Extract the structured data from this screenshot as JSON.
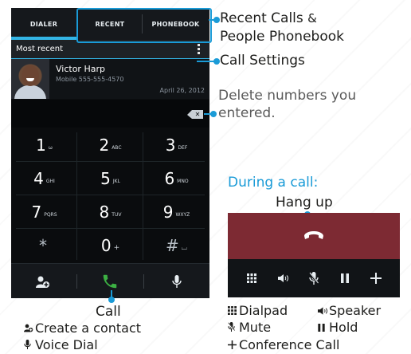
{
  "phone": {
    "tabs": [
      "DIALER",
      "RECENT",
      "PHONEBOOK"
    ],
    "recent_header": "Most recent",
    "contact": {
      "name": "Victor Harp",
      "number": "Mobile 555-555-4570",
      "date": "April 26, 2012"
    },
    "keys": [
      {
        "digit": "1",
        "letters": "ω"
      },
      {
        "digit": "2",
        "letters": "ABC"
      },
      {
        "digit": "3",
        "letters": "DEF"
      },
      {
        "digit": "4",
        "letters": "GHI"
      },
      {
        "digit": "5",
        "letters": "JKL"
      },
      {
        "digit": "6",
        "letters": "MNO"
      },
      {
        "digit": "7",
        "letters": "PQRS"
      },
      {
        "digit": "8",
        "letters": "TUV"
      },
      {
        "digit": "9",
        "letters": "WXYZ"
      },
      {
        "digit": "*",
        "letters": ""
      },
      {
        "digit": "0",
        "letters": "+"
      },
      {
        "digit": "#",
        "letters": "⌴"
      }
    ],
    "bottom_icons": [
      "add-contact-icon",
      "call-icon",
      "microphone-icon"
    ],
    "accent_color": "#33b5e5",
    "call_color": "#3cb043"
  },
  "call_screen": {
    "hangup_color": "#7d2a33",
    "tools": [
      "dialpad-icon",
      "speaker-icon",
      "mute-icon",
      "hold-icon",
      "add-icon"
    ]
  },
  "annotations": {
    "recent_calls": "Recent Calls",
    "amp": "&",
    "phonebook": "People Phonebook",
    "call_settings": "Call Settings",
    "delete_line1": "Delete numbers you",
    "delete_line2": "entered.",
    "during_call": "During a call:",
    "hang_up": "Hang up",
    "call": "Call",
    "create_contact": "Create a contact",
    "voice_dial": "Voice Dial",
    "dialpad": "Dialpad",
    "speaker": "Speaker",
    "mute": "Mute",
    "hold": "Hold",
    "conference": "Conference Call"
  },
  "annotation_color": "#1a9bd7"
}
